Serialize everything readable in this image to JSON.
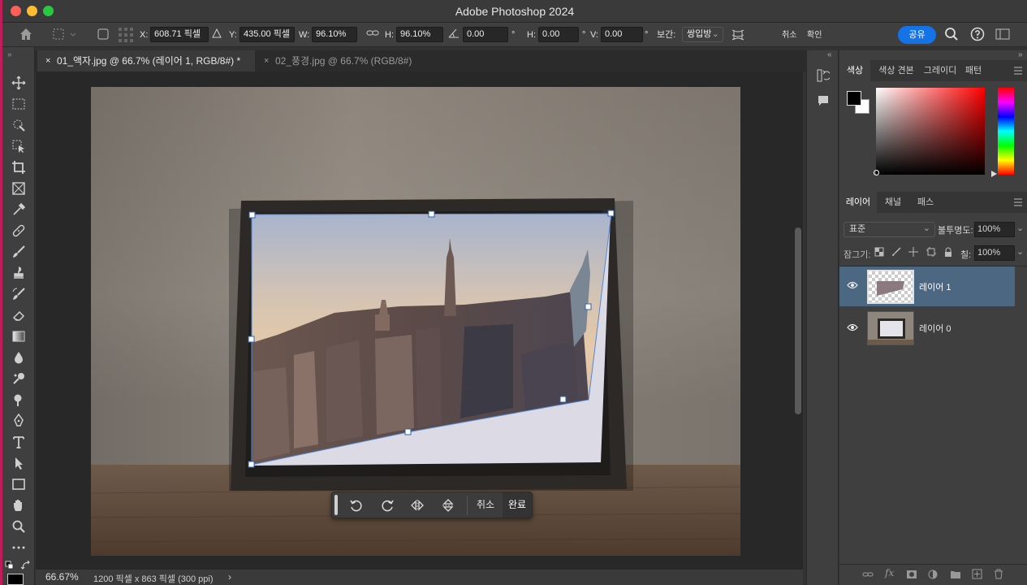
{
  "app": {
    "title": "Adobe Photoshop 2024"
  },
  "options": {
    "x_label": "X:",
    "x_value": "608.71 픽셀",
    "y_label": "Y:",
    "y_value": "435.00 픽셀",
    "w_label": "W:",
    "w_value": "96.10%",
    "h_label": "H:",
    "h_value": "96.10%",
    "angle_value": "0.00",
    "hskew_label": "H:",
    "hskew_value": "0.00",
    "vskew_label": "V:",
    "vskew_value": "0.00",
    "degree": "°",
    "interp_label": "보간:",
    "interp_value": "쌍입방",
    "cancel_label": "취소",
    "commit_label": "확인",
    "share_label": "공유"
  },
  "tabs": [
    {
      "label": "01_액자.jpg @ 66.7% (레이어 1, RGB/8#) *",
      "close": "×",
      "active": true
    },
    {
      "label": "02_풍경.jpg @ 66.7% (RGB/8#)",
      "close": "×",
      "active": false
    }
  ],
  "status": {
    "zoom": "66.67%",
    "info": "1200 픽셀 x 863 픽셀 (300 ppi)",
    "arrow": "›"
  },
  "transform_bar": {
    "cancel": "취소",
    "done": "완료"
  },
  "color_panel": {
    "tabs": [
      "색상",
      "색상 견본",
      "그레이디언",
      "패턴"
    ],
    "foreground": "#000000",
    "background": "#ffffff",
    "hue_color": "#ff0000"
  },
  "layers_panel": {
    "tabs": [
      "레이어",
      "채널",
      "패스"
    ],
    "blend_mode": "표준",
    "opacity_label": "불투명도:",
    "opacity_value": "100%",
    "lock_label": "잠그기:",
    "fill_label": "칠:",
    "fill_value": "100%",
    "layers": [
      {
        "name": "레이어 1",
        "selected": true,
        "visible": true
      },
      {
        "name": "레이어 0",
        "selected": false,
        "visible": true
      }
    ]
  },
  "tools": [
    "move-icon",
    "marquee-icon",
    "quick-select-icon",
    "object-select-icon",
    "crop-icon",
    "frame-icon",
    "eyedropper-icon",
    "healing-icon",
    "brush-icon",
    "stamp-icon",
    "history-brush-icon",
    "eraser-icon",
    "gradient-icon",
    "blur-icon",
    "dodge-icon",
    "burn-icon",
    "pen-icon",
    "type-icon",
    "path-select-icon",
    "rectangle-icon",
    "hand-icon",
    "zoom-icon",
    "more-icon"
  ],
  "colors": {
    "accent": "#1473e6",
    "selected_layer": "#4b6782"
  }
}
